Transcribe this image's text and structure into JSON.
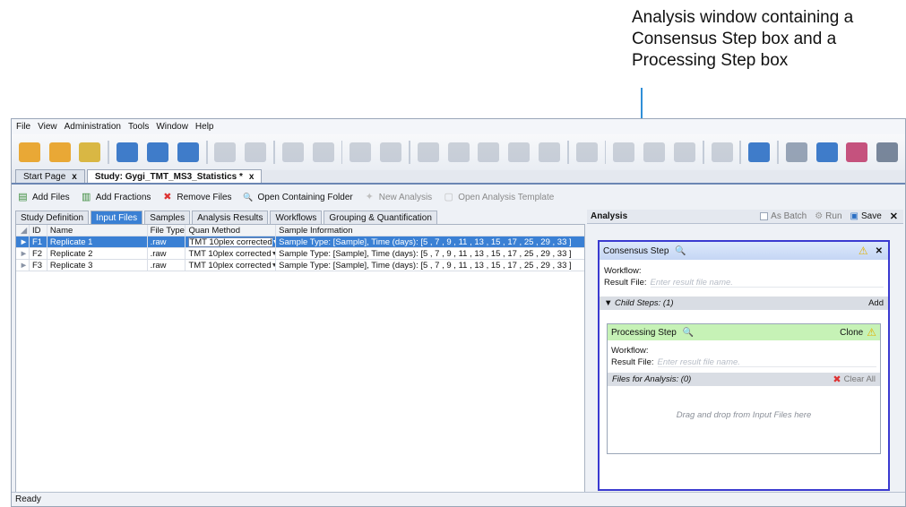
{
  "callout": {
    "text": "Analysis window containing a Consensus Step box and a Processing Step box"
  },
  "menu": [
    "File",
    "View",
    "Administration",
    "Tools",
    "Window",
    "Help"
  ],
  "toolbar_icons": [
    {
      "name": "chart-icon",
      "color": "#e8a020"
    },
    {
      "name": "chart-alt-icon",
      "color": "#e8a020"
    },
    {
      "name": "folder-chart-icon",
      "color": "#d6b030"
    },
    {
      "name": "save-icon",
      "color": "#2b6fc4"
    },
    {
      "name": "save-all-icon",
      "color": "#2b6fc4"
    },
    {
      "name": "home-icon",
      "color": "#2b6fc4"
    },
    {
      "name": "table-icon",
      "color": "#a7b1bf"
    },
    {
      "name": "filter-icon",
      "color": "#a7b1bf"
    },
    {
      "name": "spectrum-icon",
      "color": "#a7b1bf"
    },
    {
      "name": "molecule-icon",
      "color": "#a7b1bf"
    },
    {
      "name": "grid-icon",
      "color": "#a7b1bf"
    },
    {
      "name": "eye-icon",
      "color": "#a7b1bf"
    },
    {
      "name": "peak-icon",
      "color": "#a7b1bf"
    },
    {
      "name": "peak-alt-icon",
      "color": "#a7b1bf"
    },
    {
      "name": "bars-icon",
      "color": "#a7b1bf"
    },
    {
      "name": "axis-icon",
      "color": "#a7b1bf"
    },
    {
      "name": "list-icon",
      "color": "#a7b1bf"
    },
    {
      "name": "window-icon",
      "color": "#a7b1bf"
    },
    {
      "name": "wave-icon",
      "color": "#a7b1bf"
    },
    {
      "name": "bar-chart-icon",
      "color": "#a7b1bf"
    },
    {
      "name": "bar-chart-alt-icon",
      "color": "#a7b1bf"
    },
    {
      "name": "document-icon",
      "color": "#a7b1bf"
    },
    {
      "name": "hierarchy-icon",
      "color": "#2b6fc4"
    },
    {
      "name": "settings-icon",
      "color": "#8c9aae"
    },
    {
      "name": "database-icon",
      "color": "#2b6fc4"
    },
    {
      "name": "server-icon",
      "color": "#c04070"
    },
    {
      "name": "export-icon",
      "color": "#6a7a90"
    }
  ],
  "doc_tabs": [
    {
      "label": "Start Page",
      "close": "x"
    },
    {
      "label": "Study: Gygi_TMT_MS3_Statistics *",
      "close": "x"
    }
  ],
  "actions": [
    {
      "label": "Add Files",
      "icon": "▤",
      "color": "#3a8a3a"
    },
    {
      "label": "Add Fractions",
      "icon": "▥",
      "color": "#3a8a3a"
    },
    {
      "label": "Remove Files",
      "icon": "✖",
      "color": "#d33"
    },
    {
      "label": "Open Containing Folder",
      "icon": "🔍",
      "color": "#3a80d4"
    },
    {
      "label": "New Analysis",
      "icon": "✦",
      "color": "#c0c0c0"
    },
    {
      "label": "Open Analysis Template",
      "icon": "▢",
      "color": "#c0c0c0"
    }
  ],
  "sub_tabs": [
    "Study Definition",
    "Input Files",
    "Samples",
    "Analysis Results",
    "Workflows",
    "Grouping & Quantification"
  ],
  "grid": {
    "headers": [
      "ID",
      "Name",
      "File Type",
      "Quan Method",
      "Sample Information"
    ],
    "rows": [
      {
        "id": "F1",
        "name": "Replicate 1",
        "ftype": ".raw",
        "quan": "TMT 10plex corrected",
        "info": "Sample Type: [Sample], Time (days): [5 , 7 , 9 , 11 , 13 , 15 , 17 , 25 , 29 , 33 ]"
      },
      {
        "id": "F2",
        "name": "Replicate 2",
        "ftype": ".raw",
        "quan": "TMT 10plex corrected",
        "info": "Sample Type: [Sample], Time (days): [5 , 7 , 9 , 11 , 13 , 15 , 17 , 25 , 29 , 33 ]"
      },
      {
        "id": "F3",
        "name": "Replicate 3",
        "ftype": ".raw",
        "quan": "TMT 10plex corrected",
        "info": "Sample Type: [Sample], Time (days): [5 , 7 , 9 , 11 , 13 , 15 , 17 , 25 , 29 , 33 ]"
      }
    ]
  },
  "analysis": {
    "title": "Analysis",
    "as_batch": "As Batch",
    "run": "Run",
    "save": "Save",
    "close": "✕",
    "consensus": {
      "title": "Consensus Step",
      "workflow_label": "Workflow:",
      "result_label": "Result File:",
      "result_placeholder": "Enter result file name.",
      "child_steps": "Child Steps: (1)",
      "add": "Add"
    },
    "processing": {
      "title": "Processing Step",
      "clone": "Clone",
      "workflow_label": "Workflow:",
      "result_label": "Result File:",
      "result_placeholder": "Enter result file name.",
      "files_for_analysis": "Files for Analysis: (0)",
      "clear_all": "Clear All",
      "drop_hint": "Drag and drop from Input Files here"
    }
  },
  "status": "Ready"
}
